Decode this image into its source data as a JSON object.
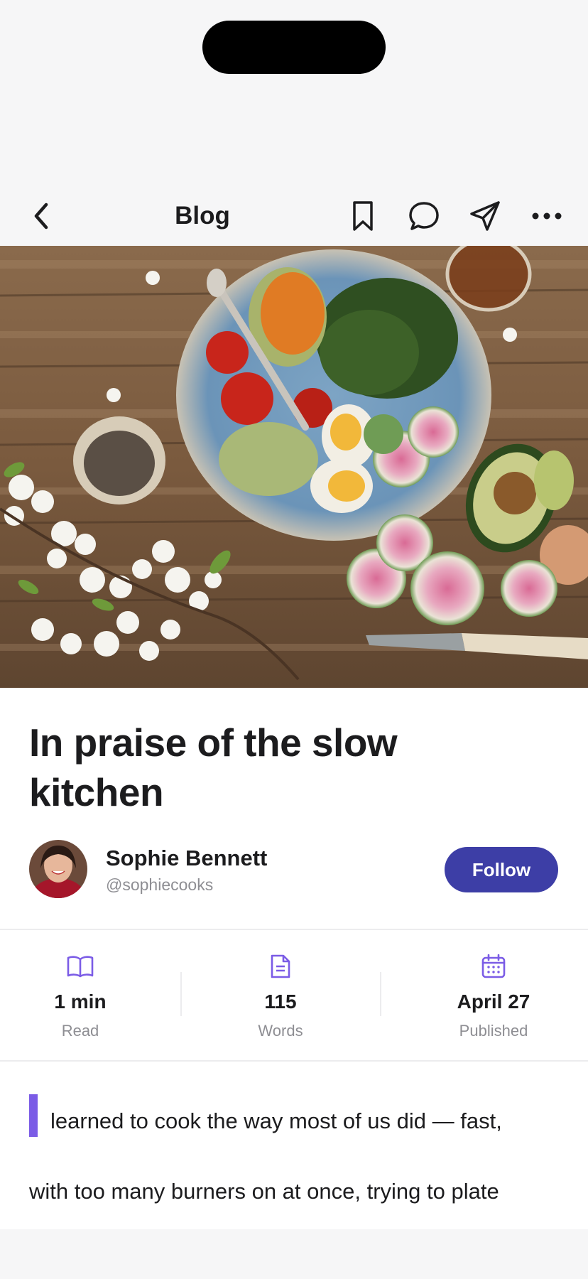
{
  "nav": {
    "title": "Blog",
    "icons": [
      "chevron-left-icon",
      "bookmark-icon",
      "comment-icon",
      "share-icon",
      "more-icon"
    ]
  },
  "post": {
    "title": "In praise of the slow kitchen",
    "author_name": "Sophie Bennett",
    "author_handle": "@sophiecooks",
    "follow_label": "Follow",
    "body_line_1": "learned to cook the way most of us did — fast,",
    "body_line_2": "with too many burners on at once, trying to plate"
  },
  "stats": [
    {
      "icon": "book-icon",
      "value": "1 min",
      "label": "Read"
    },
    {
      "icon": "document-icon",
      "value": "115",
      "label": "Words"
    },
    {
      "icon": "calendar-icon",
      "value": "April 27",
      "label": "Published"
    }
  ],
  "colors": {
    "accent": "#3d3ea6",
    "icon_accent": "#7b5ce6",
    "muted": "#8e8e93"
  }
}
